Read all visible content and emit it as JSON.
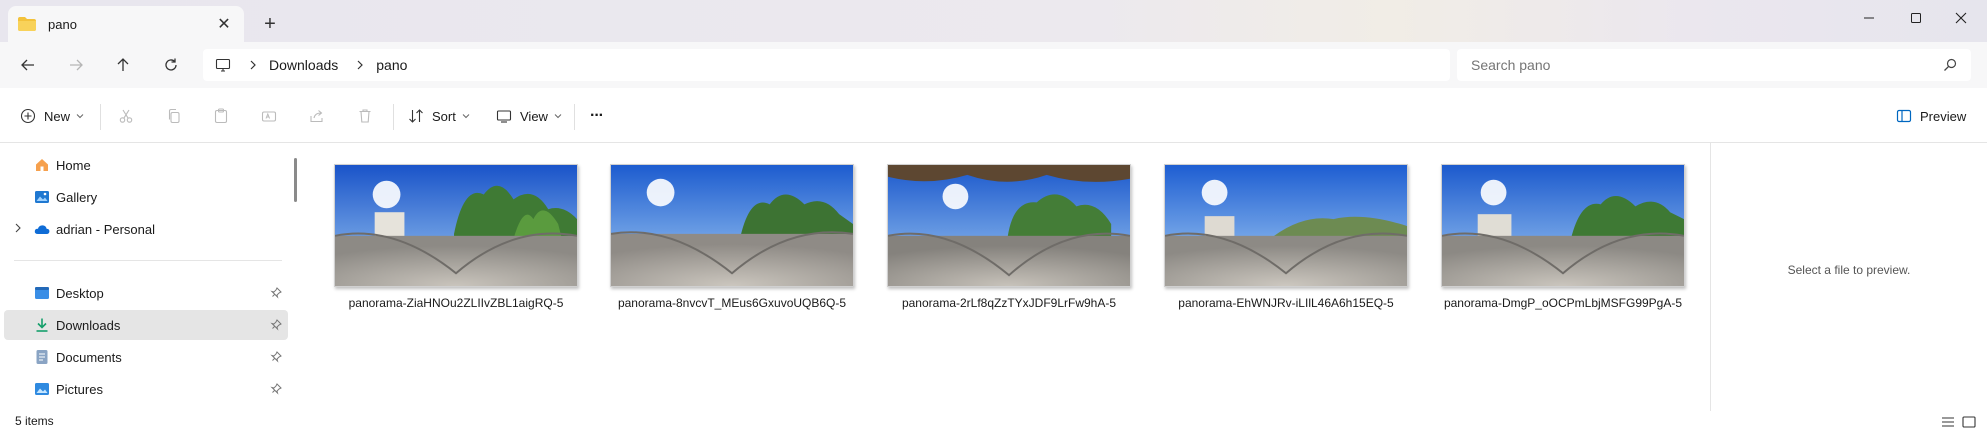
{
  "window": {
    "tab_title": "pano",
    "tab_close": "✕",
    "new_tab": "+",
    "controls": {
      "minimize": "minimize-icon",
      "maximize": "maximize-icon",
      "close": "close-icon"
    }
  },
  "navigation": {
    "breadcrumb": [
      "Downloads",
      "pano"
    ]
  },
  "search": {
    "placeholder": "Search pano"
  },
  "commandbar": {
    "new_label": "New",
    "sort_label": "Sort",
    "view_label": "View",
    "more": "···",
    "preview_label": "Preview"
  },
  "sidebar": {
    "items": [
      {
        "label": "Home",
        "icon": "home-icon"
      },
      {
        "label": "Gallery",
        "icon": "gallery-icon"
      },
      {
        "label": "adrian - Personal",
        "icon": "onedrive-icon"
      },
      {
        "label": "Desktop",
        "icon": "desktop-icon",
        "pinned": true
      },
      {
        "label": "Downloads",
        "icon": "download-icon",
        "pinned": true,
        "selected": true
      },
      {
        "label": "Documents",
        "icon": "documents-icon",
        "pinned": true
      },
      {
        "label": "Pictures",
        "icon": "pictures-icon",
        "pinned": true
      }
    ]
  },
  "files": [
    {
      "name": "panorama-ZiaHNOu2ZLIIvZBL1aigRQ-5"
    },
    {
      "name": "panorama-8nvcvT_MEus6GxuvoUQB6Q-5"
    },
    {
      "name": "panorama-2rLf8qZzTYxJDF9LrFw9hA-5"
    },
    {
      "name": "panorama-EhWNJRv-iLIlL46A6h15EQ-5"
    },
    {
      "name": "panorama-DmgP_oOCPmLbjMSFG99PgA-5"
    }
  ],
  "preview": {
    "message": "Select a file to preview."
  },
  "status": {
    "count": "5 items"
  },
  "colors": {
    "accent": "#0067c0",
    "selected_bg": "#e5e5e5",
    "folder": "#f3c23b"
  }
}
